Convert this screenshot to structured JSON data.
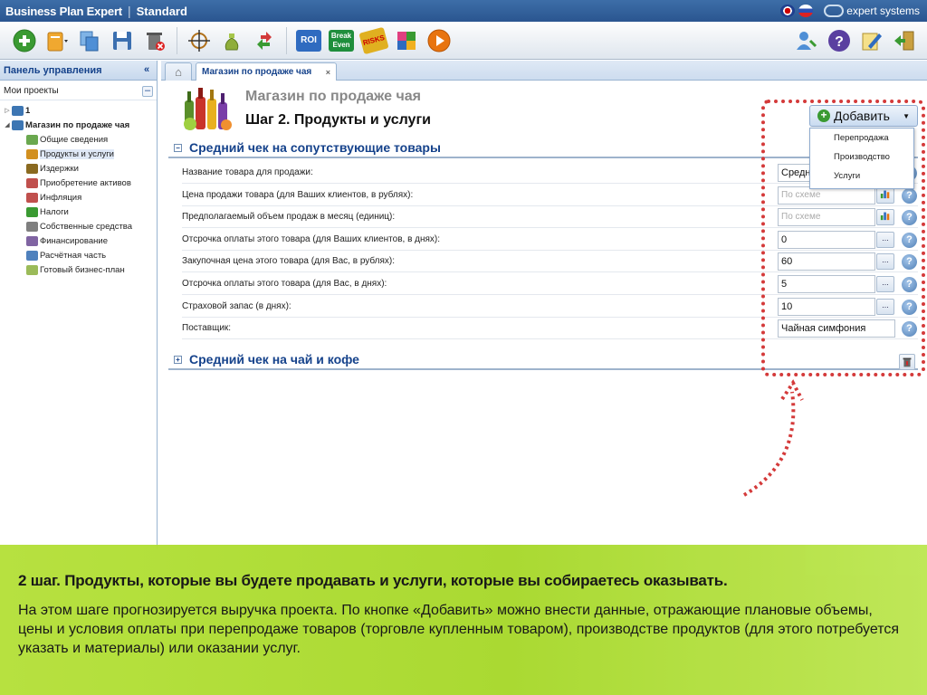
{
  "titlebar": {
    "app_name": "Business Plan Expert",
    "edition": "Standard",
    "brand": "expert systems"
  },
  "left_panel": {
    "title": "Панель управления",
    "collapse_glyph": "«",
    "subheader": "Мои проекты",
    "subheader_toggle": "–",
    "tree": [
      {
        "label": "1",
        "level": 1,
        "bold": true,
        "expander": "▷"
      },
      {
        "label": "Магазин по продаже чая",
        "level": 1,
        "bold": true,
        "expander": "◢"
      },
      {
        "label": "Общие сведения",
        "level": 2
      },
      {
        "label": "Продукты и услуги",
        "level": 2,
        "selected": true
      },
      {
        "label": "Издержки",
        "level": 2
      },
      {
        "label": "Приобретение активов",
        "level": 2
      },
      {
        "label": "Инфляция",
        "level": 2
      },
      {
        "label": "Налоги",
        "level": 2
      },
      {
        "label": "Собственные средства",
        "level": 2
      },
      {
        "label": "Финансирование",
        "level": 2
      },
      {
        "label": "Расчётная часть",
        "level": 2
      },
      {
        "label": "Готовый бизнес-план",
        "level": 2
      }
    ]
  },
  "tabs": {
    "home_glyph": "⌂",
    "project_tab": "Магазин по продаже чая",
    "close_glyph": "×"
  },
  "header": {
    "project_title": "Магазин по продаже чая",
    "step_title": "Шаг 2. Продукты и услуги"
  },
  "add_button": {
    "label": "Добавить",
    "menu": [
      "Перепродажа",
      "Производство",
      "Услуги"
    ]
  },
  "section1": {
    "title": "Средний чек на сопутствующие товары",
    "toggle": "−",
    "rows": [
      {
        "label": "Название товара для продажи:",
        "value": "Средн"
      },
      {
        "label": "Цена продажи товара (для Ваших клиентов, в рублях):",
        "value": "По схеме"
      },
      {
        "label": "Предполагаемый объем продаж в месяц (единиц):",
        "value": "По схеме"
      },
      {
        "label": "Отсрочка оплаты этого товара (для Ваших клиентов, в днях):",
        "value": "0"
      },
      {
        "label": "Закупочная цена этого товара (для Вас, в рублях):",
        "value": "60"
      },
      {
        "label": "Отсрочка оплаты этого товара (для Вас, в днях):",
        "value": "5"
      },
      {
        "label": "Страховой запас (в днях):",
        "value": "10"
      },
      {
        "label": "Поставщик:",
        "value": "Чайная симфония"
      }
    ],
    "dots_glyph": "...",
    "help_glyph": "?"
  },
  "section2": {
    "title": "Средний чек на чай и кофе",
    "toggle": "+"
  },
  "toolbar": {
    "roi_label": "ROI",
    "breakeven_label": "Break Even",
    "risks_label": "RISKS"
  },
  "note": {
    "heading": "2 шаг. Продукты, которые вы будете продавать и услуги, которые вы собираетесь оказывать.",
    "body": "На этом шаге прогнозируется выручка проекта. По кнопке «Добавить» можно внести данные, отражающие плановые объемы, цены и условия оплаты при перепродаже товаров (торговле купленным товаром), производстве продуктов (для этого потребуется указать и материалы) или оказании услуг."
  },
  "colors": {
    "titlebar": "#2f5e9a",
    "accent_blue": "#15428b",
    "note_green": "#a8d82c",
    "callout_red": "#d43a3a"
  }
}
